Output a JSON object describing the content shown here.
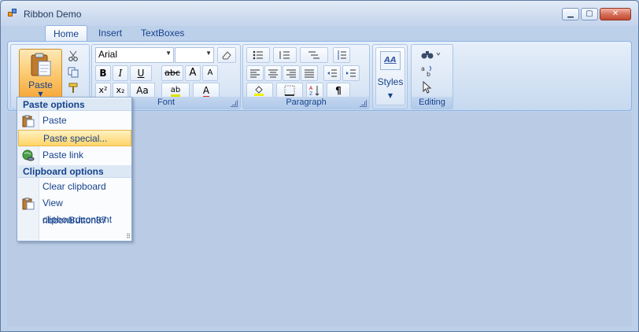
{
  "window": {
    "title": "Ribbon Demo"
  },
  "tabs": [
    {
      "label": "Home",
      "active": true
    },
    {
      "label": "Insert",
      "active": false
    },
    {
      "label": "TextBoxes",
      "active": false
    }
  ],
  "clipboard": {
    "paste_label": "Paste"
  },
  "font": {
    "group_label": "Font",
    "family_value": "Arial",
    "size_value": "",
    "bold": "B",
    "italic": "I",
    "underline": "U",
    "strike": "abc",
    "grow": "A",
    "shrink": "A",
    "superscript": "x²",
    "subscript": "x₂",
    "case": "Aa",
    "highlight": "ab",
    "font_color": "A"
  },
  "paragraph": {
    "group_label": "Paragraph"
  },
  "styles": {
    "label": "Styles"
  },
  "editing": {
    "group_label": "Editing"
  },
  "paste_menu": {
    "header_paste": "Paste options",
    "items_paste": [
      "Paste",
      "Paste special...",
      "Paste link"
    ],
    "header_clipboard": "Clipboard options",
    "items_clipboard": [
      "Clear clipboard",
      "View clipboardcontent",
      "ribbonButton87"
    ]
  },
  "colors": {
    "accent": "#15428b",
    "highlight": "#ffd467",
    "ribbon_border": "#8db2e3"
  }
}
